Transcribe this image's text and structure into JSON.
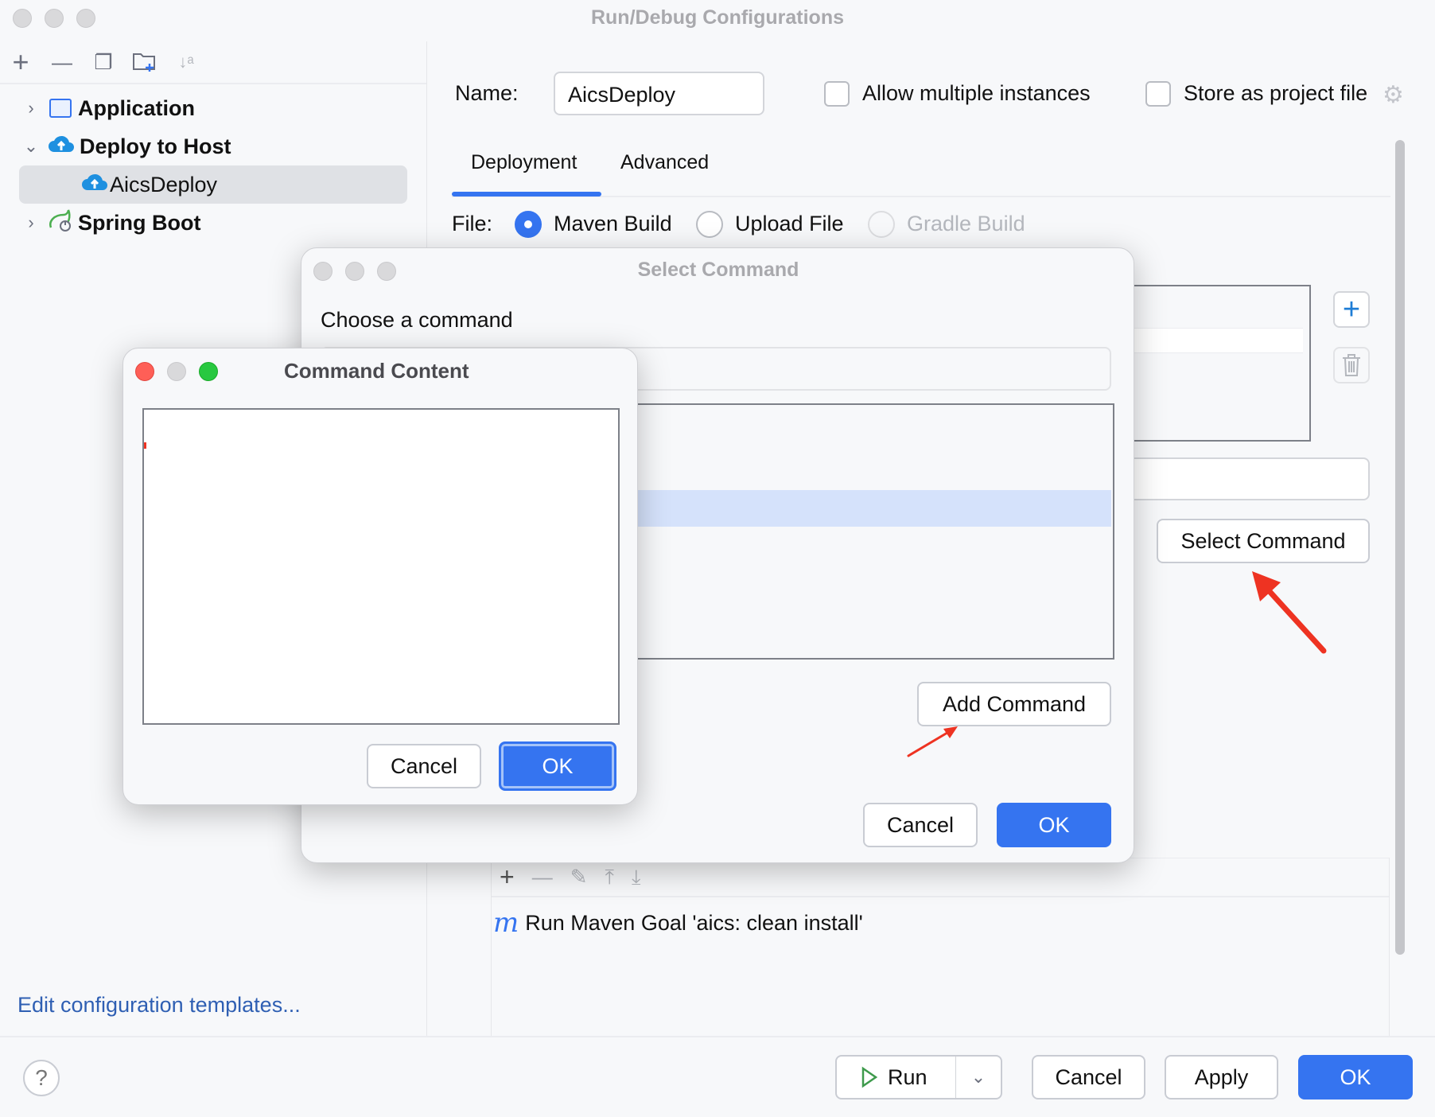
{
  "window": {
    "title": "Run/Debug Configurations"
  },
  "sidebar": {
    "toolbar": [
      {
        "icon": "plus-icon",
        "glyph": "+"
      },
      {
        "icon": "minus-icon",
        "glyph": "—"
      },
      {
        "icon": "copy-icon",
        "glyph": "❐"
      },
      {
        "icon": "new-folder-icon",
        "glyph": "🗀"
      },
      {
        "icon": "sort-alpha-icon",
        "glyph": "↓ᵃ"
      }
    ],
    "tree": [
      {
        "label": "Application",
        "expanded": false,
        "icon": "application-icon"
      },
      {
        "label": "Deploy to Host",
        "expanded": true,
        "icon": "cloud-upload-icon"
      },
      {
        "label": "AicsDeploy",
        "selected": true,
        "icon": "cloud-upload-icon"
      },
      {
        "label": "Spring Boot",
        "expanded": false,
        "icon": "spring-boot-icon"
      }
    ],
    "edit_templates_link": "Edit configuration templates..."
  },
  "config": {
    "name_label": "Name:",
    "name_value": "AicsDeploy",
    "allow_multiple_label": "Allow multiple instances",
    "allow_multiple_checked": false,
    "store_project_label": "Store as project file",
    "store_project_checked": false,
    "tabs": [
      {
        "label": "Deployment",
        "active": true
      },
      {
        "label": "Advanced",
        "active": false
      }
    ],
    "file_label": "File:",
    "file_options": [
      {
        "label": "Maven Build",
        "selected": true,
        "enabled": true
      },
      {
        "label": "Upload File",
        "selected": false,
        "enabled": true
      },
      {
        "label": "Gradle Build",
        "selected": false,
        "enabled": false
      }
    ],
    "select_command_button": "Select Command",
    "before_launch": {
      "items": [
        {
          "icon": "maven-icon",
          "glyph": "m",
          "label": "Run Maven Goal 'aics: clean install'"
        }
      ]
    }
  },
  "footer": {
    "help": "?",
    "run": "Run",
    "cancel": "Cancel",
    "apply": "Apply",
    "ok": "OK"
  },
  "select_command_dialog": {
    "title": "Select Command",
    "prompt": "Choose a command",
    "search_value": "",
    "add_command": "Add Command",
    "cancel": "Cancel",
    "ok": "OK"
  },
  "command_content_dialog": {
    "title": "Command Content",
    "content": "",
    "cancel": "Cancel",
    "ok": "OK"
  },
  "colors": {
    "accent": "#3574f0",
    "link": "#2f5fb3",
    "annotation_arrow": "#ee3322",
    "selection": "#d5e2fb"
  }
}
